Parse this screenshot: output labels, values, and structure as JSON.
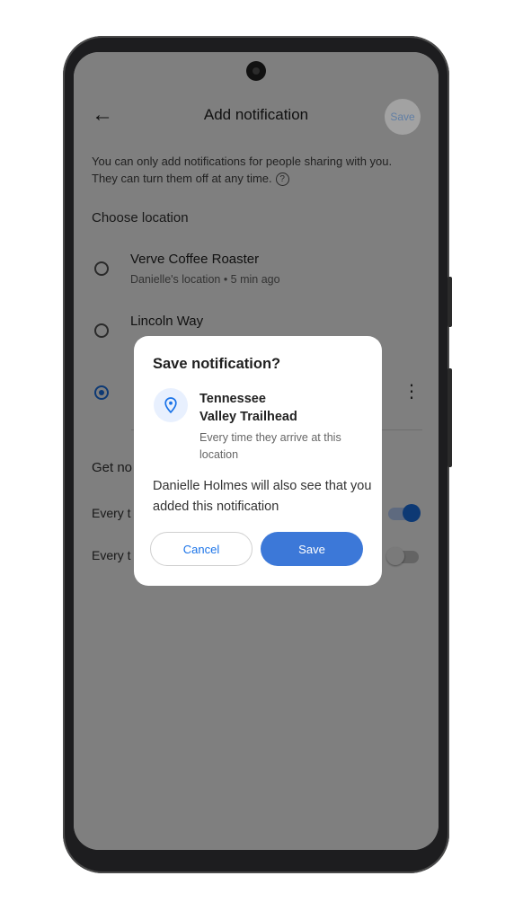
{
  "header": {
    "back_icon": "arrow-back-icon",
    "title": "Add notification",
    "save_label": "Save"
  },
  "info": {
    "text": "You can only add notifications for people sharing with you. They can turn them off at any time.",
    "help_icon": "help-circle-icon"
  },
  "choose_location": {
    "title": "Choose location",
    "options": [
      {
        "name": "Verve Coffee Roaster",
        "subtitle": "Danielle's location • 5 min ago",
        "selected": false
      },
      {
        "name": "Lincoln Way",
        "subtitle": "",
        "selected": false
      },
      {
        "name": "",
        "subtitle": "",
        "selected": true
      }
    ],
    "more_icon": "more-vert-icon"
  },
  "get_notified": {
    "title": "Get no",
    "items": [
      {
        "label": "Every t",
        "enabled": true
      },
      {
        "label": "Every t",
        "enabled": false
      }
    ]
  },
  "dialog": {
    "title": "Save notification?",
    "pin_icon": "location-pin-icon",
    "place_line1": "Tennessee",
    "place_line2": "Valley Trailhead",
    "when": "Every time they arrive at this location",
    "body": "Danielle Holmes will also see that you added this notification",
    "cancel_label": "Cancel",
    "save_label": "Save"
  },
  "colors": {
    "accent": "#1a73e8",
    "save_button": "#3c78d8",
    "pin_bg": "#e8f0fe"
  }
}
